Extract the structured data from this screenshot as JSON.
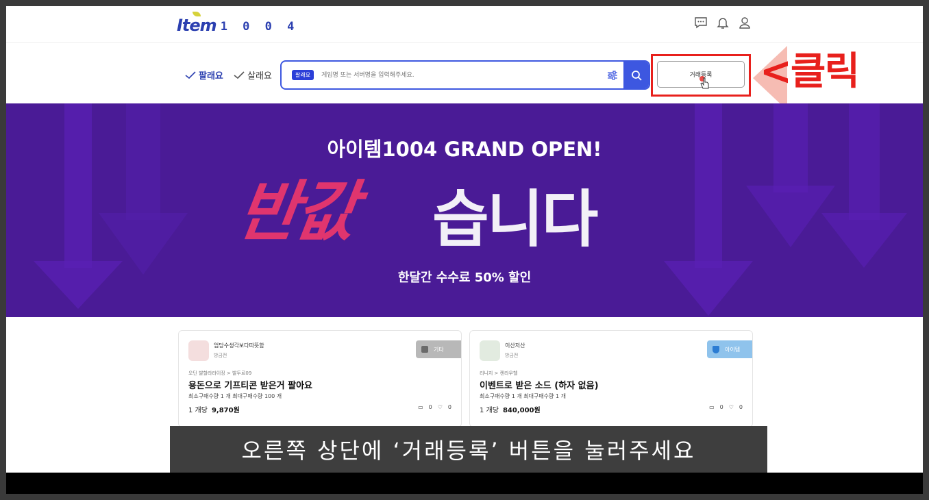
{
  "header": {
    "logo_main": "Item",
    "logo_num": "1 0 0 4",
    "icons": [
      "chat-icon",
      "bell-icon",
      "user-icon"
    ]
  },
  "nav": {
    "sell_label": "팔래요",
    "buy_label": "살래요"
  },
  "search": {
    "chip_label": "팔래요",
    "placeholder": "게임명 또는 서버명을 입력해주세요."
  },
  "register_button": {
    "label": "거래등록"
  },
  "annotation": {
    "click_label": "<클릭"
  },
  "banner": {
    "title": "아이템1004 GRAND OPEN!",
    "big_text_1": "반값",
    "big_text_2": "습니다",
    "subtitle": "한달간 수수료 50% 할인"
  },
  "cards": [
    {
      "seller": "엄당수생각보다따뜻함",
      "grade": "방금전",
      "badge": "기타",
      "path": "오딘 발할라라이징 > 발두르09",
      "title": "용돈으로 기프티콘 받은거 팔아요",
      "qty": "최소구매수량 1 개    최대구매수량 100 개",
      "price_unit": "1 개당",
      "price": "9,870원",
      "comments": "0",
      "likes": "0"
    },
    {
      "seller": "이산저산",
      "grade": "방금전",
      "badge": "아이템",
      "path": "리니지 > 켄라우헬",
      "title": "이벤트로 받은 소드 (하자 없음)",
      "qty": "최소구매수량 1 개    최대구매수량 1 개",
      "price_unit": "1 개당",
      "price": "840,000원",
      "comments": "0",
      "likes": "0"
    }
  ],
  "caption": "오른쪽 상단에 ‘거래등록’ 버튼을 눌러주세요",
  "colors": {
    "brand": "#2b3fb0",
    "search_accent": "#3d57e0",
    "banner_bg": "#4a1b96",
    "banner_pink": "#e0356e",
    "annotation_red": "#e8201c"
  }
}
